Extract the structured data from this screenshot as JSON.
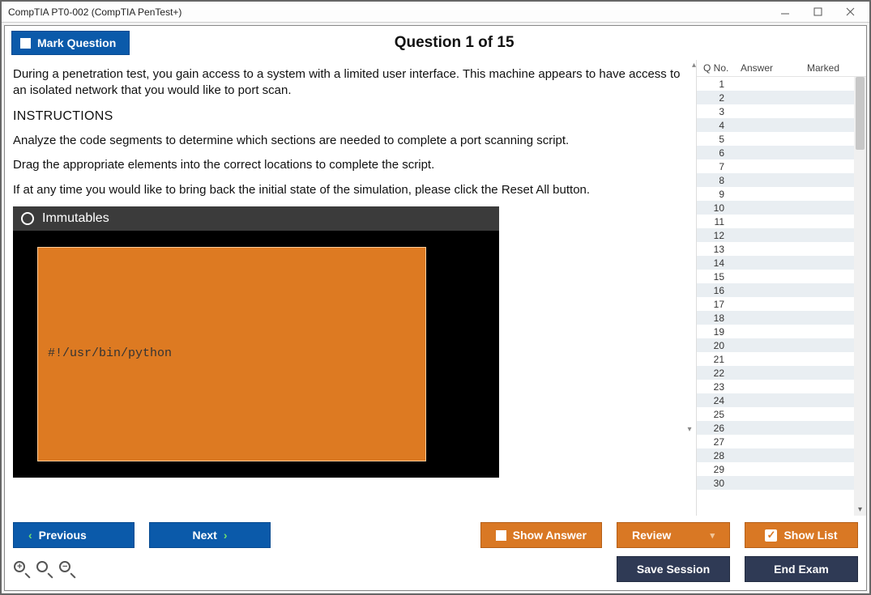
{
  "window": {
    "title": "CompTIA PT0-002 (CompTIA PenTest+)"
  },
  "header": {
    "mark_label": "Mark Question",
    "question_title": "Question 1 of 15"
  },
  "question": {
    "para1": "During a penetration test, you gain access to a system with a limited user interface. This machine appears to have access to an isolated network that you would like to port scan.",
    "instructions_head": "INSTRUCTIONS",
    "para2": "Analyze the code segments to determine which sections are needed to complete a port scanning script.",
    "para3": "Drag the appropriate elements into the correct locations to complete the script.",
    "para4": "If at any time you would like to bring back the initial state of the simulation, please click the Reset All button."
  },
  "sim": {
    "header_label": "Immutables",
    "code_line": "#!/usr/bin/python"
  },
  "sidebar": {
    "col_qno": "Q No.",
    "col_answer": "Answer",
    "col_marked": "Marked",
    "rows": [
      1,
      2,
      3,
      4,
      5,
      6,
      7,
      8,
      9,
      10,
      11,
      12,
      13,
      14,
      15,
      16,
      17,
      18,
      19,
      20,
      21,
      22,
      23,
      24,
      25,
      26,
      27,
      28,
      29,
      30
    ]
  },
  "footer": {
    "prev": "Previous",
    "next": "Next",
    "show_answer": "Show Answer",
    "review": "Review",
    "show_list": "Show List",
    "save_session": "Save Session",
    "end_exam": "End Exam"
  }
}
